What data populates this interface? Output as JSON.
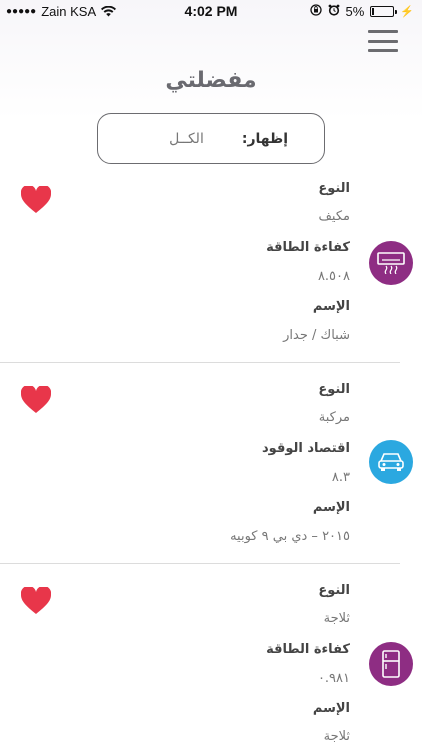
{
  "status_bar": {
    "signal": "●●●●●",
    "carrier": "Zain KSA",
    "time": "4:02 PM",
    "battery": "5%",
    "battery_level": 0.05
  },
  "header": {
    "title": "مفضلتي"
  },
  "filter": {
    "label": "إظهار:",
    "value": "الكــل"
  },
  "favorites": [
    {
      "type_label": "النوع",
      "type_value": "مكيف",
      "metric_label": "كفاءة الطاقة",
      "metric_value": "٨.٥٠٨",
      "name_label": "الإسم",
      "name_value": "شباك / جدار",
      "icon": "air-conditioner-icon",
      "icon_color": "#8e2d83"
    },
    {
      "type_label": "النوع",
      "type_value": "مركبة",
      "metric_label": "اقتصاد الوقود",
      "metric_value": "٨.٣",
      "name_label": "الإسم",
      "name_value": "٢٠١٥ – دي بي ٩ كوبيه",
      "icon": "car-icon",
      "icon_color": "#2ba8e0"
    },
    {
      "type_label": "النوع",
      "type_value": "ثلاجة",
      "metric_label": "كفاءة الطاقة",
      "metric_value": "٠.٩٨١",
      "name_label": "الإسم",
      "name_value": "ثلاجة",
      "icon": "refrigerator-icon",
      "icon_color": "#8e2d83"
    }
  ],
  "colors": {
    "heart": "#e8364a",
    "divider": "#dcdcdc"
  }
}
